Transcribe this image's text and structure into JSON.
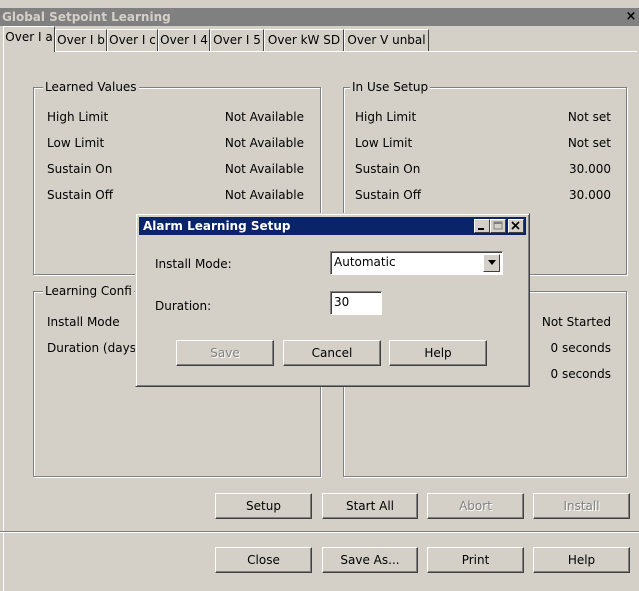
{
  "window": {
    "title": "Global Setpoint Learning",
    "close_glyph": "×"
  },
  "tabs": [
    "Over I a",
    "Over I b",
    "Over I c",
    "Over I 4",
    "Over I 5",
    "Over kW SD",
    "Over V unbal"
  ],
  "learned_values": {
    "title": "Learned Values",
    "rows": [
      {
        "label": "High Limit",
        "value": "Not Available"
      },
      {
        "label": "Low Limit",
        "value": "Not Available"
      },
      {
        "label": "Sustain On",
        "value": "Not Available"
      },
      {
        "label": "Sustain Off",
        "value": "Not Available"
      }
    ]
  },
  "in_use_setup": {
    "title": "In Use Setup",
    "rows": [
      {
        "label": "High Limit",
        "value": "Not set"
      },
      {
        "label": "Low Limit",
        "value": "Not set"
      },
      {
        "label": "Sustain On",
        "value": "30.000"
      },
      {
        "label": "Sustain Off",
        "value": "30.000"
      }
    ]
  },
  "learning_config": {
    "title": "Learning Confi",
    "rows": [
      {
        "label": "Install Mode"
      },
      {
        "label": "Duration (days"
      }
    ]
  },
  "status_values": [
    "Not Started",
    "0 seconds",
    "0 seconds"
  ],
  "panel_buttons": {
    "setup": "Setup",
    "start_all": "Start All",
    "abort": "Abort",
    "install": "Install"
  },
  "footer_buttons": {
    "close": "Close",
    "save_as": "Save As...",
    "print": "Print",
    "help": "Help"
  },
  "dialog": {
    "title": "Alarm Learning Setup",
    "install_mode_label": "Install Mode:",
    "install_mode_value": "Automatic",
    "duration_label": "Duration:",
    "duration_value": "30",
    "save": "Save",
    "cancel": "Cancel",
    "help": "Help"
  }
}
